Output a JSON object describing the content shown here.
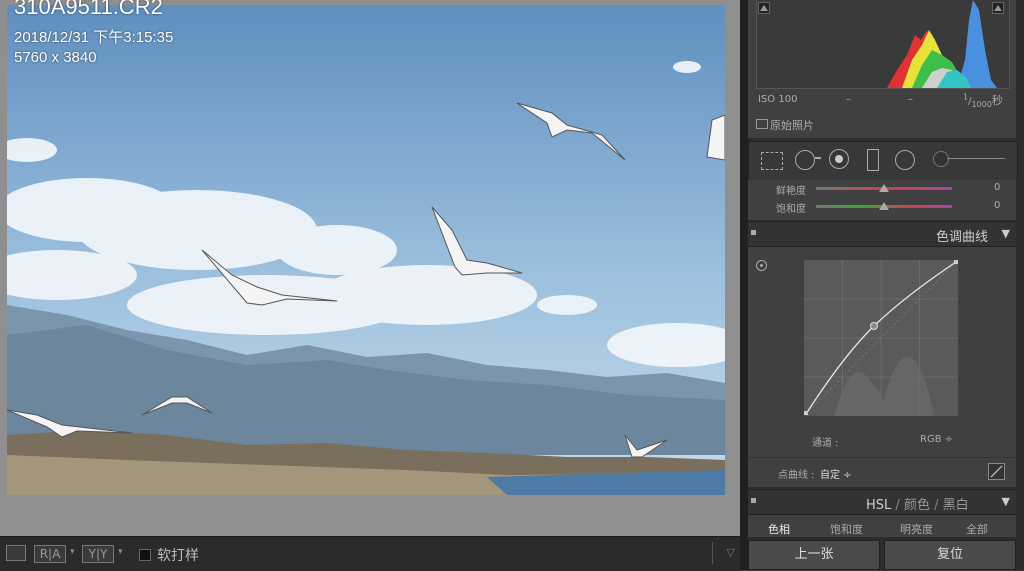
{
  "photo": {
    "filename": "310A9511.CR2",
    "datetime": "2018/12/31 下午3:15:35",
    "dimensions": "5760 x 3840"
  },
  "toolbar": {
    "compare_label_1": "R|A",
    "compare_label_2": "Y|Y",
    "soft_proof_label": "软打样"
  },
  "histogram": {
    "iso": "ISO 100",
    "dash1": "–",
    "dash2": "–",
    "shutter_num": "1",
    "shutter_den": "1000",
    "shutter_unit": "秒",
    "original_photo_label": "原始照片"
  },
  "basic": {
    "vibrance_label": "鲜艳度",
    "vibrance_value": "0",
    "saturation_label": "饱和度",
    "saturation_value": "0"
  },
  "tone_curve": {
    "title": "色调曲线",
    "channel_label": "通道 :",
    "channel_value": "RGB",
    "point_curve_label": "点曲线 :",
    "point_curve_value": "自定"
  },
  "hsl": {
    "title_hsl": "HSL",
    "sep": "/",
    "title_color": "颜色",
    "title_bw": "黑白",
    "tabs": [
      "色相",
      "饱和度",
      "明亮度",
      "全部"
    ]
  },
  "buttons": {
    "previous": "上一张",
    "reset": "复位"
  },
  "colors": {
    "panel_bg": "#404040",
    "header_bg": "#333333",
    "viewer_bg": "#8f8f8f"
  }
}
